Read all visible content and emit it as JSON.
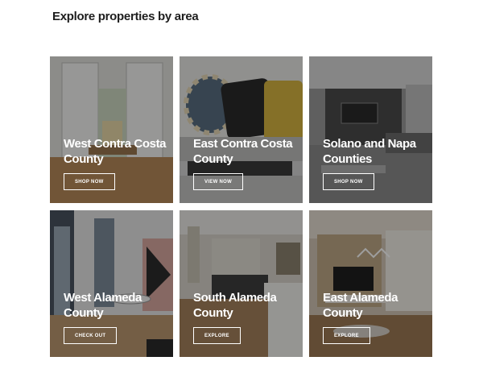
{
  "page": {
    "title": "Explore properties by area"
  },
  "cards": [
    {
      "label": "West Contra Costa County",
      "button": "SHOP NOW"
    },
    {
      "label": "East Contra Costa County",
      "button": "VIEW NOW"
    },
    {
      "label": "Solano and Napa Counties",
      "button": "SHOP NOW"
    },
    {
      "label": "West Alameda County",
      "button": "CHECK OUT"
    },
    {
      "label": "South Alameda County",
      "button": "EXPLORE"
    },
    {
      "label": "East Alameda County",
      "button": "EXPLORE"
    }
  ]
}
